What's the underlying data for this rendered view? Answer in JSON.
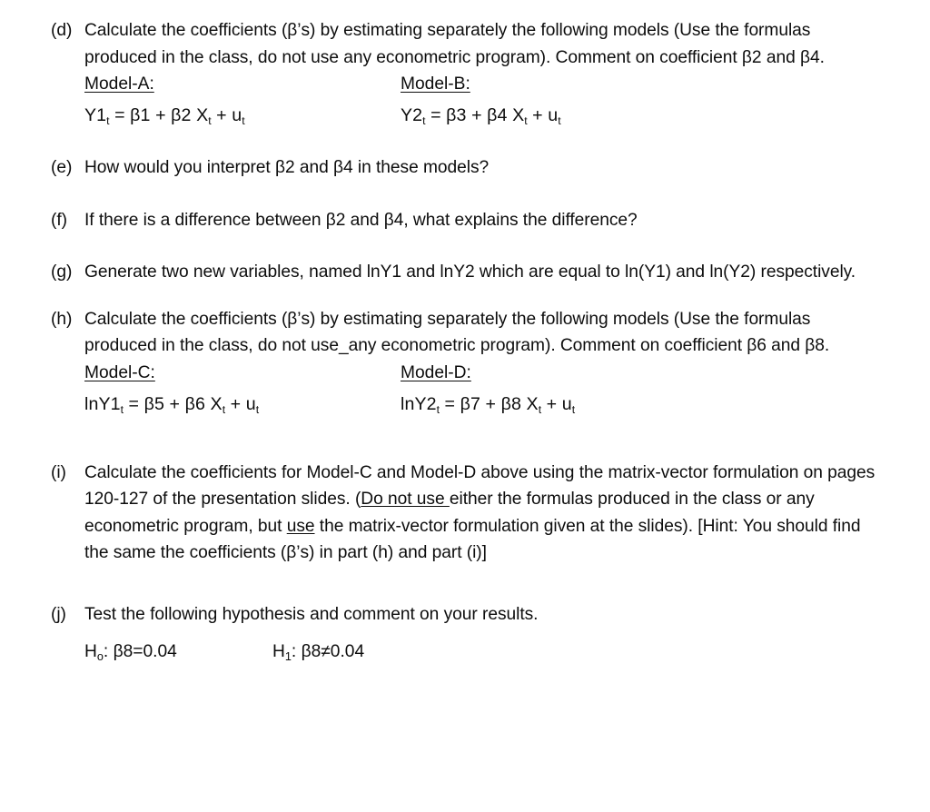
{
  "document": {
    "type": "homework-assignment-excerpt",
    "background_color": "#ffffff",
    "text_color": "#0d0d0d"
  },
  "items": {
    "d": {
      "marker": "(d)",
      "text": "Calculate the coefficients (β’s) by estimating separately the following models (Use the formulas produced in the class, do not use any econometric program). Comment on coefficient β2 and β4."
    },
    "e": {
      "marker": "(e)",
      "text": "How would you interpret β2 and β4 in these models?"
    },
    "f": {
      "marker": "(f)",
      "text": "If there is a difference between β2 and β4, what explains the difference?"
    },
    "g": {
      "marker": "(g)",
      "text": "Generate two new variables, named lnY1 and lnY2 which are equal to ln(Y1) and ln(Y2) respectively."
    },
    "h": {
      "marker": "(h)",
      "text": "Calculate the coefficients (β’s) by estimating separately the following models (Use the formulas produced in the class, do not use_any econometric program). Comment on coefficient β6 and β8."
    },
    "i": {
      "marker": "(i)",
      "part1": "Calculate the coefficients for Model-C and Model-D above using the matrix-vector formulation on pages 120-127 of the presentation slides. (",
      "underline1": "Do not use ",
      "part2": "either the formulas produced in the class or any econometric program, but ",
      "underline2": "use",
      "part3": " the matrix-vector formulation given at the slides). [Hint: You should find the same the coefficients (β’s) in part (h) and part (i)]"
    },
    "j": {
      "marker": "(j)",
      "text": "Test the following hypothesis and comment on your results."
    }
  },
  "models_ab": {
    "col1_heading": "Model-A:",
    "col2_heading": "Model-B:",
    "col1_formula": {
      "lhs": "Y1",
      "lhs_sub": "t",
      "mid": " = β1 + β2 X",
      "x_sub": "t",
      "tail": " + u",
      "u_sub": "t"
    },
    "col2_formula": {
      "lhs": "Y2",
      "lhs_sub": "t",
      "mid": " = β3 + β4 X",
      "x_sub": "t",
      "tail": " + u",
      "u_sub": "t"
    }
  },
  "models_cd": {
    "col1_heading": "Model-C:",
    "col2_heading": "Model-D:",
    "col1_formula": {
      "lhs": "lnY1",
      "lhs_sub": "t",
      "mid": " = β5 + β6 X",
      "x_sub": "t",
      "tail": " + u",
      "u_sub": "t"
    },
    "col2_formula": {
      "lhs": "lnY2",
      "lhs_sub": "t",
      "mid": " = β7 + β8 X",
      "x_sub": "t",
      "tail": " + u",
      "u_sub": "t"
    }
  },
  "hypothesis": {
    "null_label": "H",
    "null_sub": "o",
    "null_statement": ": β8=0.04",
    "alt_label": "H",
    "alt_sub": "1",
    "alt_statement": ": β8≠0.04"
  }
}
